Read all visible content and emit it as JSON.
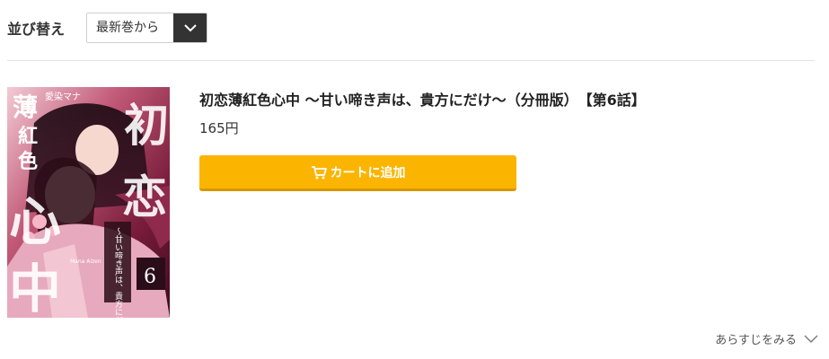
{
  "sort": {
    "label": "並び替え",
    "selected": "最新巻から"
  },
  "book": {
    "title": "初恋薄紅色心中 ～甘い啼き声は、貴方にだけ～（分冊版）　【第6話】",
    "price": "165円",
    "cart_button_label": "カートに追加",
    "synopsis_link": "あらすじをみる",
    "cover": {
      "title_chars": [
        "初",
        "恋",
        "薄",
        "紅",
        "色",
        "心",
        "中"
      ],
      "subtitle": "～甘い啼き声は、貴方にだけ～",
      "author": "愛染マナ",
      "author_romaji": "Mana Aizen",
      "volume": "6"
    }
  },
  "colors": {
    "accent": "#fbb500",
    "accent_dark": "#d99600",
    "dark": "#333333"
  },
  "icons": {
    "sort_toggle": "chevron-down-icon",
    "cart": "cart-icon",
    "synopsis": "chevron-down-icon"
  }
}
